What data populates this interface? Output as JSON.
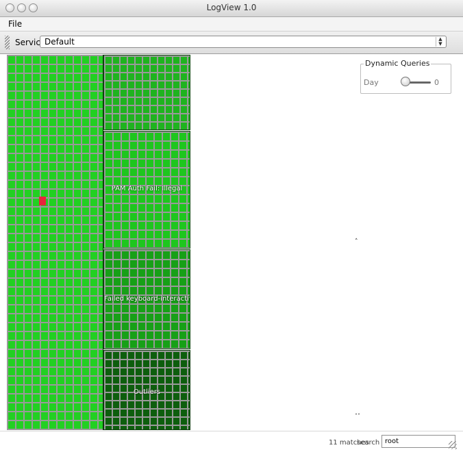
{
  "window": {
    "title": "LogView 1.0"
  },
  "menubar": {
    "file": "File"
  },
  "toolbar": {
    "service_label": "Service:",
    "service_value": "Default"
  },
  "treemap": {
    "tiles": [
      {
        "label": ""
      },
      {
        "label": ""
      },
      {
        "label": "PAM Auth Fail: Illegal"
      },
      {
        "label": "Failed keyboard-interactive/pam"
      },
      {
        "label": "Outliers"
      }
    ],
    "colors": {
      "main": "#22d022",
      "highlight": "#e8243c",
      "outliers": "#0d5e0d"
    }
  },
  "dynamic_queries": {
    "title": "Dynamic Queries",
    "day_label": "Day",
    "day_value": "0"
  },
  "markers": {
    "mid": "˄",
    "bottom": "˄˅"
  },
  "status": {
    "matches": "11 matches",
    "search_label": "search >>",
    "search_value": "root"
  },
  "icons": {
    "window_buttons": "traffic-light-icons",
    "resize": "resize-grip-icon",
    "grip": "toolbar-grip-icon"
  }
}
